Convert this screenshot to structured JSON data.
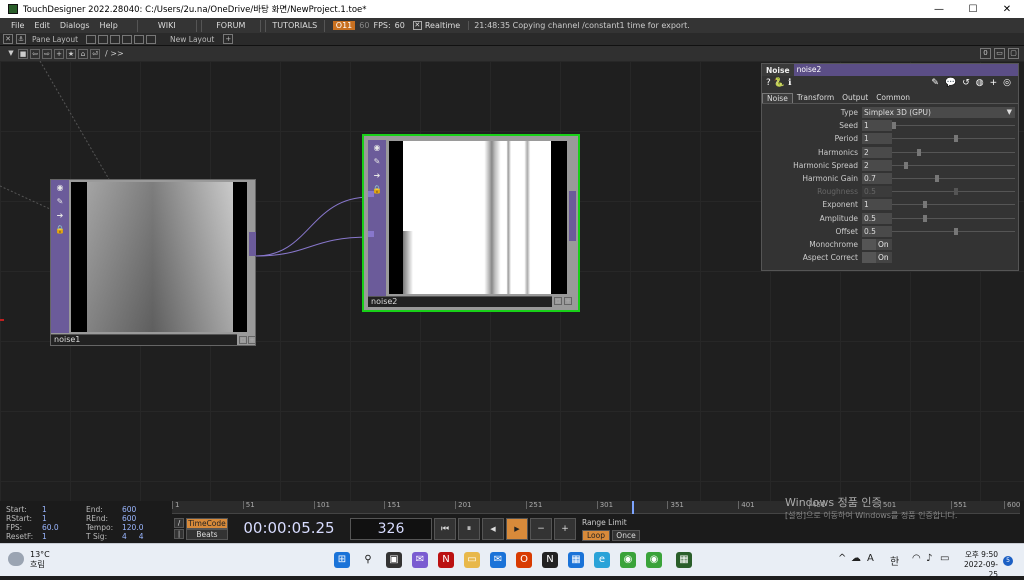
{
  "titlebar": {
    "title": "TouchDesigner 2022.28040: C:/Users/2u.na/OneDrive/바탕 화면/NewProject.1.toe*",
    "minimize": "—",
    "maximize": "☐",
    "close": "✕"
  },
  "menubar": {
    "items": [
      "File",
      "Edit",
      "Dialogs",
      "Help"
    ],
    "wiki": "WIKI",
    "forum": "FORUM",
    "tutorials": "TUTORIALS",
    "perf": "O11",
    "fps_cook": "60",
    "fps_label": "FPS:",
    "fps_value": "60",
    "realtime_check": "✕",
    "realtime_label": "Realtime",
    "message": "21:48:35 Copying channel /constant1 time for export."
  },
  "panebar": {
    "pane_layout": "Pane Layout",
    "new_layout": "New Layout",
    "add": "+"
  },
  "navbar": {
    "path": "/ >>",
    "right_count": "0"
  },
  "nodes": {
    "noise1": {
      "name": "noise1"
    },
    "noise2": {
      "name": "noise2"
    }
  },
  "param": {
    "op_type": "Noise",
    "op_name": "noise2",
    "tabs": [
      "Noise",
      "Transform",
      "Output",
      "Common"
    ],
    "rows": [
      {
        "label": "Type",
        "value": "Simplex 3D (GPU)",
        "kind": "menu"
      },
      {
        "label": "Seed",
        "value": "1",
        "slider": 0.0
      },
      {
        "label": "Period",
        "value": "1",
        "slider": 0.5
      },
      {
        "label": "Harmonics",
        "value": "2",
        "slider": 0.2
      },
      {
        "label": "Harmonic Spread",
        "value": "2",
        "slider": 0.1
      },
      {
        "label": "Harmonic Gain",
        "value": "0.7",
        "slider": 0.35
      },
      {
        "label": "Roughness",
        "value": "0.5",
        "slider": 0.5,
        "disabled": true
      },
      {
        "label": "Exponent",
        "value": "1",
        "slider": 0.25
      },
      {
        "label": "Amplitude",
        "value": "0.5",
        "slider": 0.25
      },
      {
        "label": "Offset",
        "value": "0.5",
        "slider": 0.5
      },
      {
        "label": "Monochrome",
        "value": "On",
        "kind": "toggle"
      },
      {
        "label": "Aspect Correct",
        "value": "On",
        "kind": "toggle"
      }
    ]
  },
  "timeline": {
    "start_label": "Start:",
    "start": "1",
    "end_label": "End:",
    "end": "600",
    "rstart_label": "RStart:",
    "rstart": "1",
    "rend_label": "REnd:",
    "rend": "600",
    "fps_label": "FPS:",
    "fps": "60.0",
    "tempo_label": "Tempo:",
    "tempo": "120.0",
    "resetf_label": "ResetF:",
    "resetf": "1",
    "tsig_label": "T Sig:",
    "tsig_a": "4",
    "tsig_b": "4",
    "ticks": [
      "1",
      "51",
      "101",
      "151",
      "201",
      "251",
      "301",
      "351",
      "401",
      "451",
      "501",
      "551",
      "600"
    ],
    "current_frame": 326,
    "total_frames": 600,
    "timecode_btn": "TimeCode",
    "beats_btn": "Beats",
    "timecode": "00:00:05.25",
    "frame": "326",
    "range_limit": "Range Limit",
    "loop": "Loop",
    "once": "Once",
    "btn_start": "⏮",
    "btn_pause": "⏸",
    "btn_back": "◀",
    "btn_play": "▶",
    "btn_minus": "−",
    "btn_plus": "+"
  },
  "watermark": {
    "line1": "Windows 정품 인증",
    "line2": "[설정]으로 이동하여 Windows를 정품 인증합니다."
  },
  "taskbar": {
    "temp": "13°C",
    "weather": "흐림",
    "lang": "A",
    "ime": "한",
    "time": "오후 9:50",
    "date": "2022-09-25",
    "notif": "5",
    "chevron": "^"
  }
}
